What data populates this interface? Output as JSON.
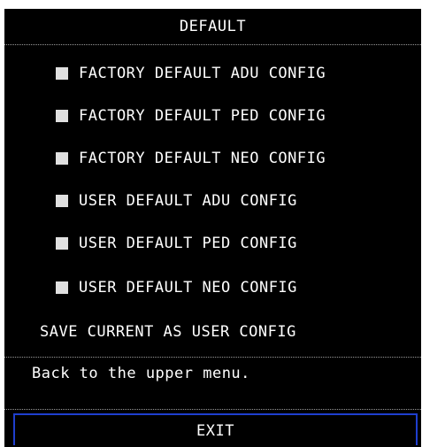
{
  "menu": {
    "title": "DEFAULT",
    "options": [
      {
        "label": "FACTORY DEFAULT ADU CONFIG"
      },
      {
        "label": "FACTORY DEFAULT PED CONFIG"
      },
      {
        "label": "FACTORY DEFAULT NEO CONFIG"
      },
      {
        "label": "USER DEFAULT ADU CONFIG"
      },
      {
        "label": "USER DEFAULT PED CONFIG"
      },
      {
        "label": "USER DEFAULT NEO CONFIG"
      }
    ],
    "save_label": "SAVE CURRENT AS USER CONFIG",
    "help_text": "Back to the upper menu.",
    "exit_label": "EXIT"
  },
  "colors": {
    "background": "#000000",
    "text": "#ffffff",
    "checkbox": "#e0e0e0",
    "exit_border": "#1f3fcf"
  }
}
